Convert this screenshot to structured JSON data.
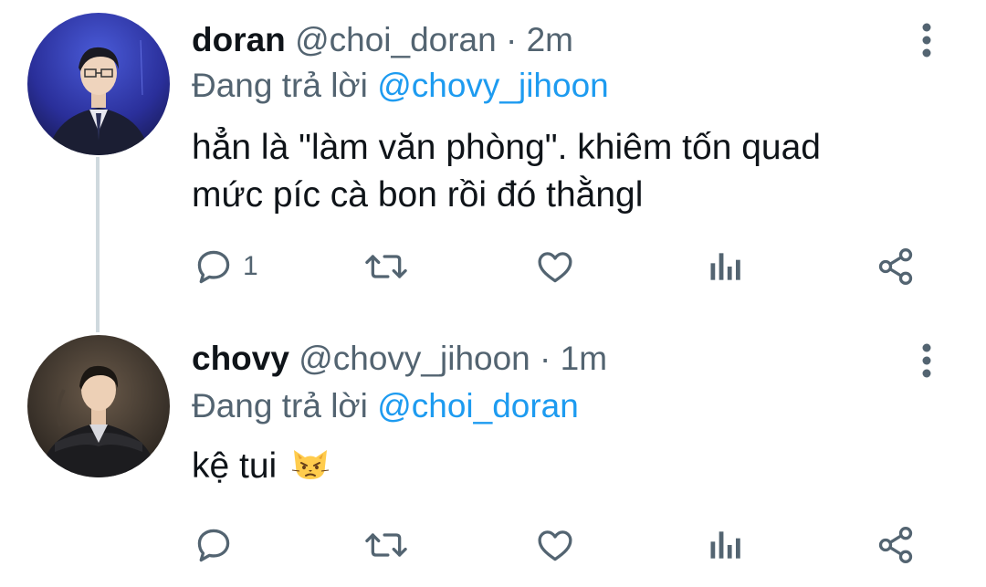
{
  "tweets": [
    {
      "name": "doran",
      "handle": "@choi_doran",
      "separator": "·",
      "time": "2m",
      "reply_prefix": "Đang trả lời",
      "reply_to": "@chovy_jihoon",
      "text_line1": "hẳn là \"làm văn phòng\". khiêm tốn quad",
      "text_line2": "mức píc cà bon rồi đó thằngl",
      "reply_count": "1"
    },
    {
      "name": "chovy",
      "handle": "@chovy_jihoon",
      "separator": "·",
      "time": "1m",
      "reply_prefix": "Đang trả lời",
      "reply_to": "@choi_doran",
      "text": "kệ tui",
      "reply_count": ""
    }
  ],
  "icons": {
    "reply": "reply-icon",
    "retweet": "retweet-icon",
    "like": "heart-icon",
    "analytics": "analytics-icon",
    "share": "share-icon",
    "more": "more-vertical-icon",
    "emoji": "pouting-cat-emoji"
  },
  "colors": {
    "text": "#0f1419",
    "secondary": "#536471",
    "accent": "#1d9bf0",
    "thread_line": "#cfd9de"
  }
}
